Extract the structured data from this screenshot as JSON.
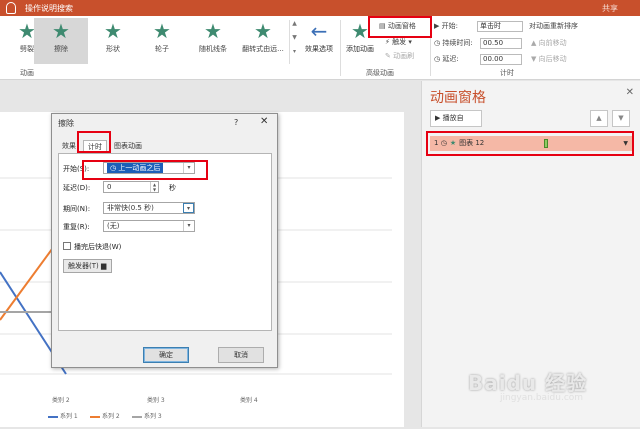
{
  "titlebar": {
    "search": "操作说明搜索",
    "user": "共享"
  },
  "ribbon": {
    "effects": [
      {
        "label": "劈裂",
        "icon": "star-icon"
      },
      {
        "label": "擦除",
        "icon": "star-icon",
        "selected": true
      },
      {
        "label": "形状",
        "icon": "star-icon"
      },
      {
        "label": "轮子",
        "icon": "star-icon"
      },
      {
        "label": "随机线条",
        "icon": "star-icon"
      },
      {
        "label": "翻转式由远...",
        "icon": "star-icon"
      }
    ],
    "effect_options": "效果选项",
    "group_animation": "动画",
    "add_animation": "添加动画",
    "animation_pane": "动画窗格",
    "trigger": "触发",
    "anim_painter": "动画刷",
    "group_advanced": "高级动画",
    "start_label": "开始:",
    "start_value": "单击时",
    "duration_label": "持续时间:",
    "duration_value": "00.50",
    "delay_label": "延迟:",
    "delay_value": "00.00",
    "reorder_label": "对动画重新排序",
    "move_earlier": "向前移动",
    "move_later": "向后移动",
    "group_timing": "计时"
  },
  "pane": {
    "title": "动画窗格",
    "play_button": "播放自",
    "items": [
      {
        "index": "1",
        "name": "图表 12"
      }
    ]
  },
  "dialog": {
    "title": "擦除",
    "help": "?",
    "close": "✕",
    "tabs": [
      "效果",
      "计时",
      "图表动画"
    ],
    "start_label": "开始(S):",
    "start_value": "上一动画之后",
    "delay_label": "延迟(D):",
    "delay_value": "0",
    "delay_unit": "秒",
    "period_label": "期间(N):",
    "period_value": "非常快(0.5 秒)",
    "repeat_label": "重复(R):",
    "repeat_value": "(无)",
    "rewind_label": "播完后快退(W)",
    "trigger_button": "触发器(T)",
    "ok": "确定",
    "cancel": "取消"
  },
  "chart_data": {
    "type": "line",
    "categories": [
      "类别 1",
      "类别 2",
      "类别 3",
      "类别 4"
    ],
    "series": [
      {
        "name": "系列 1",
        "color": "#4472c4"
      },
      {
        "name": "系列 2",
        "color": "#ed7d31"
      },
      {
        "name": "系列 3",
        "color": "#a5a5a5"
      }
    ]
  },
  "watermark": {
    "logo": "Baidu 经验",
    "url": "jingyan.baidu.com"
  }
}
